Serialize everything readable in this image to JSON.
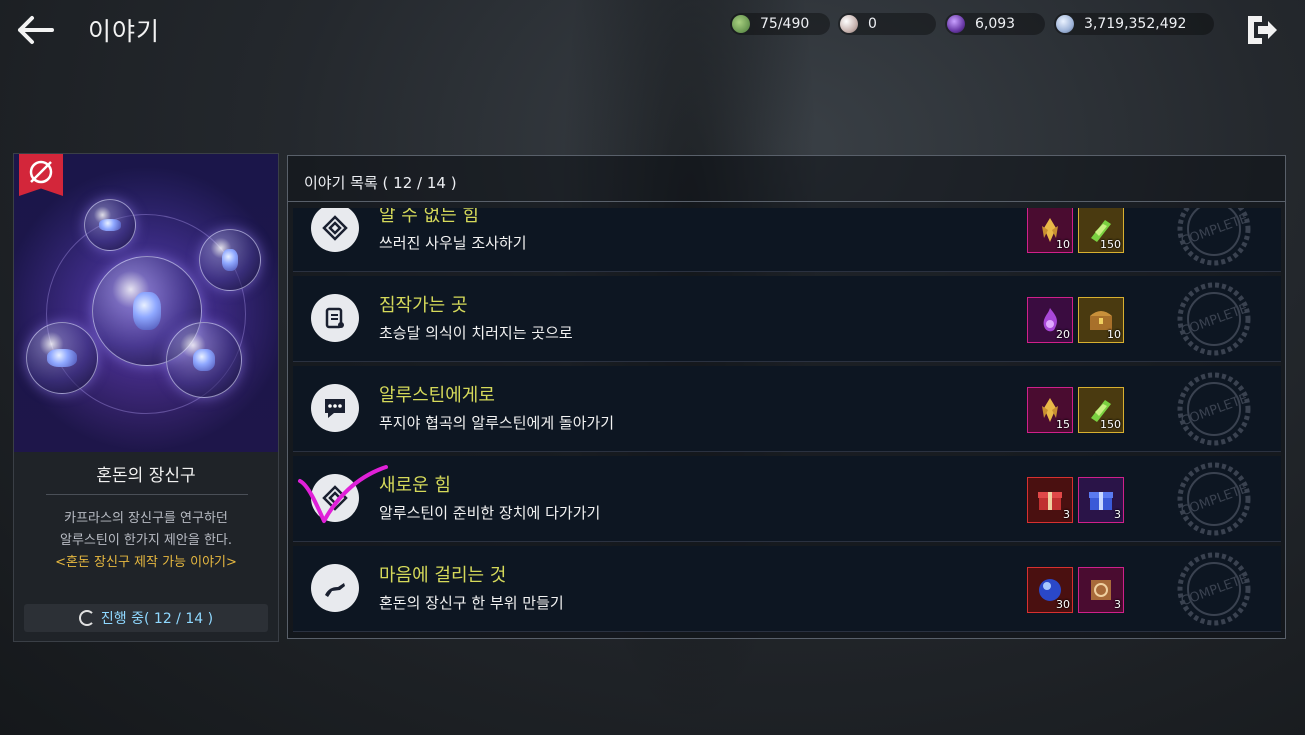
{
  "header": {
    "title": "이야기",
    "currencies": [
      {
        "value": "75/490",
        "icon": "stamina-icon",
        "color": "#5a9a4a"
      },
      {
        "value": "0",
        "icon": "pearl-icon",
        "color": "#c8b4b0"
      },
      {
        "value": "6,093",
        "icon": "purple-gem-icon",
        "color": "#6a3aa8"
      },
      {
        "value": "3,719,352,492",
        "icon": "silver-coin-icon",
        "color": "#9fb4d8"
      }
    ]
  },
  "card": {
    "title": "혼돈의 장신구",
    "desc_line1": "카프라스의 장신구를 연구하던",
    "desc_line2": "알루스틴이 한가지 제안을 한다.",
    "desc_highlight": "<혼돈 장신구 제작 가능 이야기>",
    "progress": "진행 중( 12 / 14 )"
  },
  "list": {
    "header": "이야기 목록 ( 12 / 14 )",
    "rows": [
      {
        "title": "알 수 없는 힘",
        "subtitle": "쓰러진 사우닐 조사하기",
        "icon": "diamond-quest-icon",
        "rewards": [
          {
            "qty": "10",
            "name": "gold-crystal-reward",
            "frame": "#d0208a"
          },
          {
            "qty": "150",
            "name": "green-crystal-reward",
            "frame": "#d8b030"
          }
        ]
      },
      {
        "title": "짐작가는 곳",
        "subtitle": "초승달 의식이 치러지는 곳으로",
        "icon": "scroll-quest-icon",
        "rewards": [
          {
            "qty": "20",
            "name": "purple-essence-reward",
            "frame": "#d0208a"
          },
          {
            "qty": "10",
            "name": "treasure-chest-reward",
            "frame": "#d8b030"
          }
        ]
      },
      {
        "title": "알루스틴에게로",
        "subtitle": "푸지야 협곡의 알루스틴에게 돌아가기",
        "icon": "chat-bubble-icon",
        "rewards": [
          {
            "qty": "15",
            "name": "gold-crystal-reward",
            "frame": "#d0208a"
          },
          {
            "qty": "150",
            "name": "green-crystal-reward",
            "frame": "#d8b030"
          }
        ]
      },
      {
        "title": "새로운 힘",
        "subtitle": "알루스틴이 준비한 장치에 다가가기",
        "icon": "diamond-quest-icon",
        "rewards": [
          {
            "qty": "3",
            "name": "red-gift-box-reward",
            "frame": "#d83030"
          },
          {
            "qty": "3",
            "name": "blue-gift-box-reward",
            "frame": "#d0208a"
          }
        ]
      },
      {
        "title": "마음에 걸리는 것",
        "subtitle": "혼돈의 장신구 한 부위 만들기",
        "icon": "hand-quest-icon",
        "rewards": [
          {
            "qty": "30",
            "name": "blue-orb-reward",
            "frame": "#d83030"
          },
          {
            "qty": "3",
            "name": "recipe-scroll-reward",
            "frame": "#d0208a"
          }
        ]
      }
    ],
    "stamp_text": "COMPLETE"
  }
}
